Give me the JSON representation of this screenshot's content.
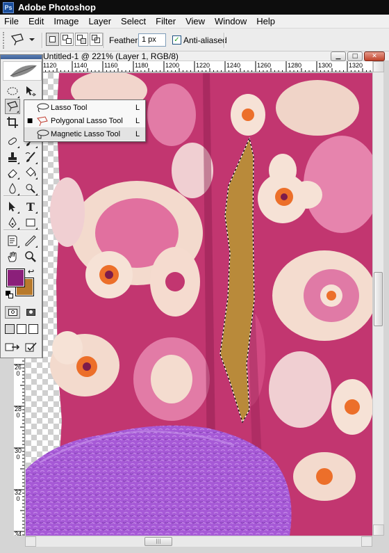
{
  "titlebar": {
    "app_icon": "Ps",
    "title": "Adobe Photoshop"
  },
  "menu": [
    "File",
    "Edit",
    "Image",
    "Layer",
    "Select",
    "Filter",
    "View",
    "Window",
    "Help"
  ],
  "options": {
    "feather_label": "Feather:",
    "feather_value": "1 px",
    "antialias_label": "Anti-aliased",
    "antialias_checked": true
  },
  "document": {
    "title": "Untitled-1 @ 221% (Layer 1, RGB/8)",
    "ruler_h": [
      "1120",
      "1140",
      "1160",
      "1180",
      "1200",
      "1220",
      "1240",
      "1260",
      "1280",
      "1300",
      "1320"
    ],
    "ruler_v": [
      "260",
      "280",
      "300",
      "320",
      "340"
    ]
  },
  "flyout": {
    "items": [
      {
        "label": "Lasso Tool",
        "key": "L",
        "active": false,
        "icon": "lasso-icon"
      },
      {
        "label": "Polygonal Lasso Tool",
        "key": "L",
        "active": true,
        "icon": "polygonal-lasso-icon"
      },
      {
        "label": "Magnetic Lasso Tool",
        "key": "L",
        "active": false,
        "icon": "magnetic-lasso-icon"
      }
    ]
  },
  "colors": {
    "foreground": "#8b1f7a",
    "background": "#b87a2c",
    "fabric_base": "#c23670",
    "fur": "#a257d4"
  }
}
